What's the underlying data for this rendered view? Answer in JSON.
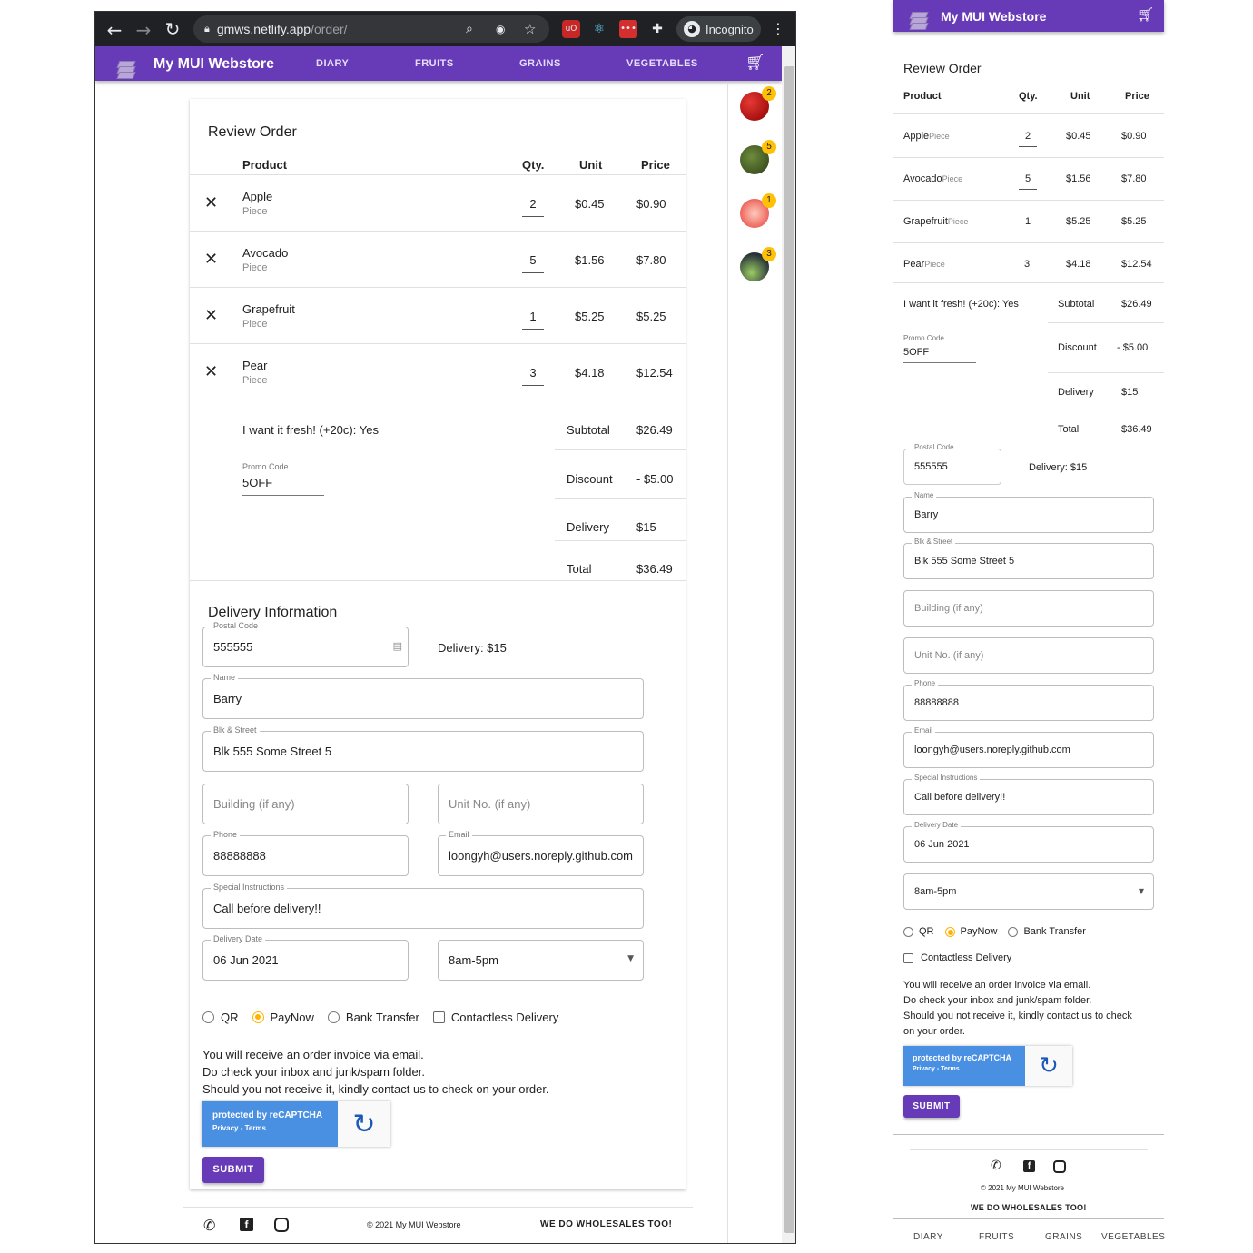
{
  "browser": {
    "url_host": "gmws.netlify.app",
    "url_path": "/order/",
    "incognito_label": "Incognito"
  },
  "app": {
    "brand": "My MUI Webstore",
    "nav": [
      "DIARY",
      "FRUITS",
      "GRAINS",
      "VEGETABLES"
    ],
    "cart_icon": "cart-icon"
  },
  "side_cart": [
    {
      "name": "apple",
      "count": "2",
      "color": "#c62828"
    },
    {
      "name": "avocado",
      "count": "5",
      "color": "#4e6b2e"
    },
    {
      "name": "grapefruit",
      "count": "1",
      "color": "#e57366"
    },
    {
      "name": "pear",
      "count": "3",
      "color": "#7c8a3a"
    }
  ],
  "review": {
    "title": "Review Order",
    "headers": {
      "product": "Product",
      "qty": "Qty.",
      "unit": "Unit",
      "price": "Price"
    },
    "items": [
      {
        "name": "Apple",
        "uom": "Piece",
        "qty": "2",
        "unit": "$0.45",
        "price": "$0.90"
      },
      {
        "name": "Avocado",
        "uom": "Piece",
        "qty": "5",
        "unit": "$1.56",
        "price": "$7.80"
      },
      {
        "name": "Grapefruit",
        "uom": "Piece",
        "qty": "1",
        "unit": "$5.25",
        "price": "$5.25"
      },
      {
        "name": "Pear",
        "uom": "Piece",
        "qty": "3",
        "unit": "$4.18",
        "price": "$12.54"
      }
    ],
    "fresh": "I want it fresh! (+20c): Yes",
    "promo_label": "Promo Code",
    "promo_value": "5OFF",
    "subtotal_label": "Subtotal",
    "subtotal": "$26.49",
    "discount_label": "Discount",
    "discount": "- $5.00",
    "delivery_label": "Delivery",
    "delivery": "$15",
    "total_label": "Total",
    "total": "$36.49"
  },
  "delivery": {
    "title": "Delivery Information",
    "postal_label": "Postal Code",
    "postal": "555555",
    "delivery_note": "Delivery: $15",
    "name_label": "Name",
    "name": "Barry",
    "street_label": "Blk & Street",
    "street": "Blk 555 Some Street 5",
    "building_ph": "Building (if any)",
    "unit_ph": "Unit No. (if any)",
    "phone_label": "Phone",
    "phone": "88888888",
    "email_label": "Email",
    "email": "loongyh@users.noreply.github.com",
    "instr_label": "Special Instructions",
    "instr": "Call before delivery!!",
    "date_label": "Delivery Date",
    "date": "06 Jun 2021",
    "slot": "8am-5pm",
    "pay_options": [
      "QR",
      "PayNow",
      "Bank Transfer"
    ],
    "pay_selected": "PayNow",
    "contactless": "Contactless Delivery",
    "note1": "You will receive an order invoice via email.",
    "note2": "Do check your inbox and junk/spam folder.",
    "note3": "Should you not receive it, kindly contact us to check on your order.",
    "m_note3a": "Should you not receive it, kindly contact us to check",
    "m_note3b": "on your order.",
    "recaptcha": "protected by reCAPTCHA",
    "recaptcha_links": "Privacy - Terms",
    "submit": "SUBMIT"
  },
  "footer": {
    "copyright": "© 2021 My MUI Webstore",
    "wholesale": "WE DO WHOLESALES TOO!"
  },
  "colors": {
    "primary": "#673ab7",
    "accent": "#ffc107"
  }
}
